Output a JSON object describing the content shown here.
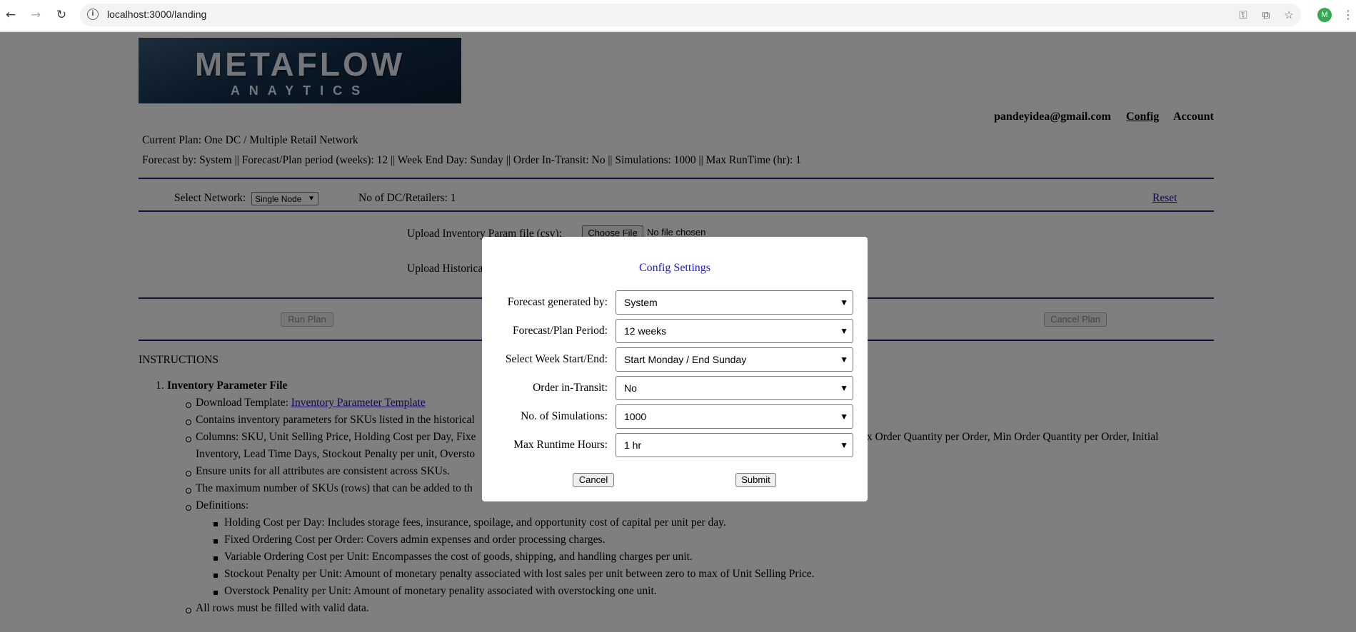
{
  "browser": {
    "url": "localhost:3000/landing",
    "avatar_letter": "M"
  },
  "logo": {
    "main": "METAFLOW",
    "sub": "ANAYTICS"
  },
  "topnav": {
    "email": "pandeyidea@gmail.com",
    "config": "Config",
    "account": "Account"
  },
  "plan": {
    "current": "Current Plan: One DC / Multiple Retail Network",
    "summary": "Forecast by: System || Forecast/Plan period (weeks): 12 || Week End Day: Sunday || Order In-Transit: No || Simulations: 1000 || Max RunTime (hr): 1"
  },
  "network": {
    "select_label": "Select Network:",
    "select_value": "Single Node",
    "count": "No of DC/Retailers: 1",
    "reset": "Reset"
  },
  "upload": {
    "inventory_label": "Upload Inventory Param file (csv):",
    "historical_label": "Upload Historica",
    "choose_file": "Choose File",
    "no_file": "No file chosen"
  },
  "actions": {
    "run_plan": "Run Plan",
    "cancel_plan": "Cancel Plan"
  },
  "instructions": {
    "heading": "INSTRUCTIONS",
    "item1_num": "1.",
    "item1_title": "Inventory Parameter File",
    "download_prefix": "Download Template: ",
    "download_link": "Inventory Parameter Template",
    "contains": "Contains inventory parameters for SKUs listed in the historical",
    "columns_start": "Columns: SKU, Unit Selling Price, Holding Cost per Day, Fixe",
    "columns_end": "ax Order Quantity per Order, Min Order Quantity per Order, Initial",
    "columns_line2": "Inventory, Lead Time Days, Stockout Penalty per unit, Oversto",
    "units": "Ensure units for all attributes are consistent across SKUs.",
    "max_skus": "The maximum number of SKUs (rows) that can be added to th",
    "definitions": "Definitions:",
    "def1": "Holding Cost per Day: Includes storage fees, insurance, spoilage, and opportunity cost of capital per unit per day.",
    "def2": "Fixed Ordering Cost per Order: Covers admin expenses and order processing charges.",
    "def3": "Variable Ordering Cost per Unit: Encompasses the cost of goods, shipping, and handling charges per unit.",
    "def4": "Stockout Penalty per Unit: Amount of monetary penalty associated with lost sales per unit between zero to max of Unit Selling Price.",
    "def5": "Overstock Penality per Unit: Amount of monetary penality associated with overstocking one unit.",
    "all_rows": "All rows must be filled with valid data."
  },
  "modal": {
    "title": "Config Settings",
    "rows": [
      {
        "label": "Forecast generated by:",
        "value": "System"
      },
      {
        "label": "Forecast/Plan Period:",
        "value": "12 weeks"
      },
      {
        "label": "Select Week Start/End:",
        "value": "Start Monday / End Sunday"
      },
      {
        "label": "Order in-Transit:",
        "value": "No"
      },
      {
        "label": "No. of Simulations:",
        "value": "1000"
      },
      {
        "label": "Max Runtime Hours:",
        "value": "1 hr"
      }
    ],
    "cancel": "Cancel",
    "submit": "Submit"
  }
}
